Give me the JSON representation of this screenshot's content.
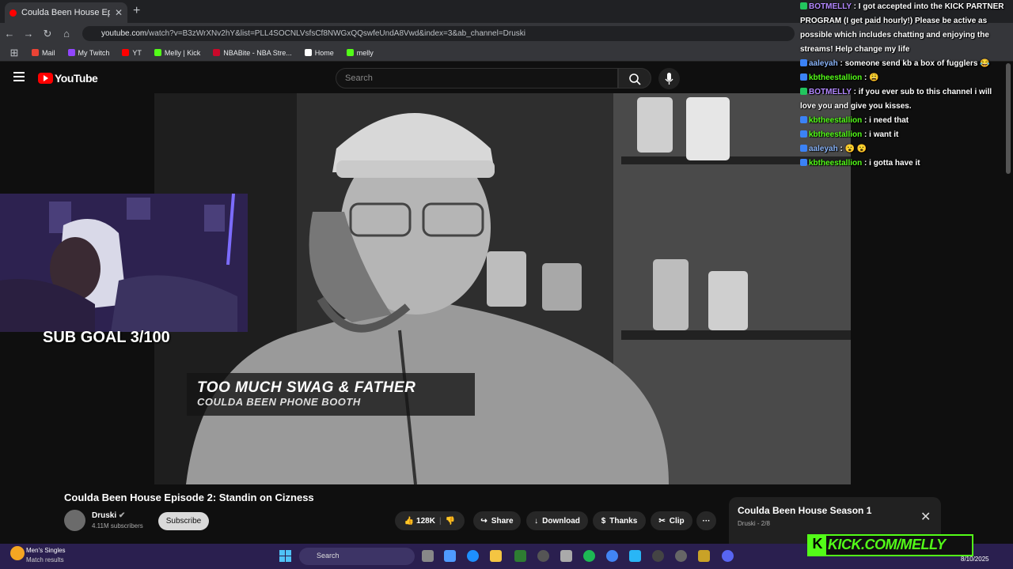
{
  "browser": {
    "tab_title": "Coulda Been House Episod",
    "url_domain": "youtube.com",
    "url_rest": "/watch?v=B3zWrXNv2hY&list=PLL4SOCNLVsfsCf8NWGxQQswfeUndA8Vwd&index=3&ab_channel=Druski",
    "bookmarks": [
      {
        "label": "Mail",
        "color": "#ea4335"
      },
      {
        "label": "My Twitch",
        "color": "#9146ff"
      },
      {
        "label": "YT",
        "color": "#ff0000"
      },
      {
        "label": "Melly | Kick",
        "color": "#53fc18"
      },
      {
        "label": "NBABite - NBA Stre...",
        "color": "#c9082a"
      },
      {
        "label": "Home",
        "color": "#ffffff"
      },
      {
        "label": "melly",
        "color": "#53fc18"
      }
    ]
  },
  "youtube": {
    "logo_text": "YouTube",
    "search_placeholder": "Search"
  },
  "video": {
    "overlay_title": "TOO MUCH SWAG & FATHER",
    "overlay_subtitle": "COULDA BEEN PHONE BOOTH",
    "title": "Coulda Been House Episode 2: Standin on Cizness",
    "channel": "Druski",
    "subscribers": "4.11M subscribers",
    "subscribe_label": "Subscribe",
    "likes": "128K",
    "share_label": "Share",
    "download_label": "Download",
    "thanks_label": "Thanks",
    "clip_label": "Clip",
    "more_label": "···"
  },
  "playlist": {
    "title": "Coulda Been House Season 1",
    "subtitle": "Druski - 2/8"
  },
  "stream": {
    "sub_goal": "SUB GOAL 3/100",
    "kick_url": "KICK.COM/MELLY"
  },
  "chat": [
    {
      "user": "BOTMELLY",
      "user_color": "purple",
      "text": ": I got accepted into the KICK PARTNER PROGRAM (I get paid hourly!) Please be active as possible which includes chatting and enjoying the streams! Help change my life"
    },
    {
      "user": "aaleyah",
      "user_color": "blue",
      "text": ": someone send kb a box of fugglers 😂"
    },
    {
      "user": "kbtheestallion",
      "user_color": "green",
      "text": ": 😩"
    },
    {
      "user": "BOTMELLY",
      "user_color": "purple",
      "text": ": if you ever sub to this channel i will love you and give you kisses."
    },
    {
      "user": "kbtheestallion",
      "user_color": "green",
      "text": ": i need that"
    },
    {
      "user": "kbtheestallion",
      "user_color": "green",
      "text": ": i want it"
    },
    {
      "user": "aaleyah",
      "user_color": "blue",
      "text": ": 😮 😮"
    },
    {
      "user": "kbtheestallion",
      "user_color": "green",
      "text": ": i gotta have it"
    }
  ],
  "taskbar": {
    "weather_title": "Men's Singles",
    "weather_sub": "Match results",
    "search_label": "Search",
    "date": "8/10/2025"
  }
}
